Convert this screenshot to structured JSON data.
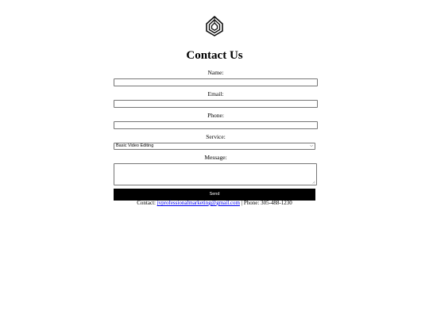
{
  "logo": {
    "icon": "geometric-logo-icon"
  },
  "title": "Contact Us",
  "form": {
    "name_label": "Name:",
    "name_value": "",
    "email_label": "Email:",
    "email_value": "",
    "phone_label": "Phone:",
    "phone_value": "",
    "service_label": "Service:",
    "service_selected": "Basic Video Editing",
    "message_label": "Message:",
    "message_value": "",
    "send_label": "Send"
  },
  "footer": {
    "prefix": "Contact: ",
    "email_link": "jvprofessionalmarketing@gmail.com",
    "separator": " | Phone: ",
    "phone": "305-488-1230"
  }
}
